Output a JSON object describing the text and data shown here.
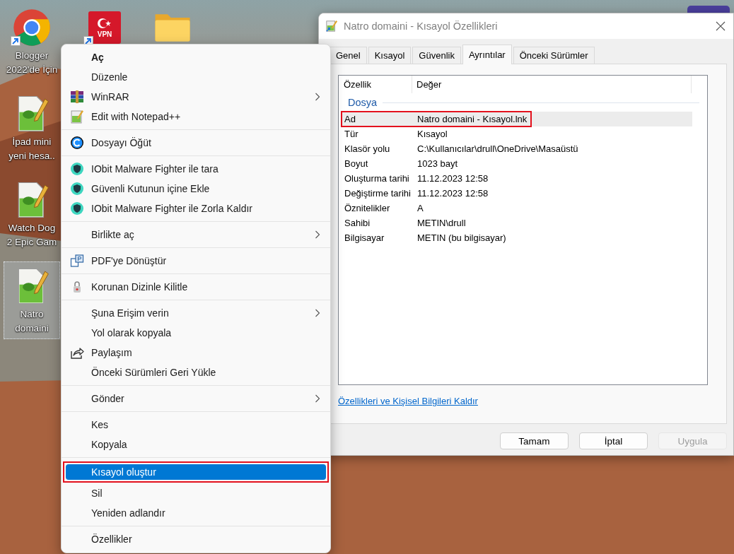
{
  "desktop": {
    "icons": [
      {
        "kind": "chrome",
        "shortcut": true,
        "selected": false,
        "label": [
          "Blogger",
          "2022'de İçin"
        ]
      },
      {
        "kind": "notepad",
        "shortcut": false,
        "selected": false,
        "label": [
          "İpad mini",
          "yeni hesa.."
        ]
      },
      {
        "kind": "notepad",
        "shortcut": false,
        "selected": false,
        "label": [
          "Watch Dog",
          "2 Epic Gam"
        ]
      },
      {
        "kind": "notepad",
        "shortcut": false,
        "selected": true,
        "label": [
          "Natro",
          "domaini"
        ]
      },
      {
        "kind": "vpn",
        "shortcut": true,
        "selected": false,
        "logo_text": "VPN"
      },
      {
        "kind": "folder",
        "shortcut": false,
        "selected": false
      }
    ]
  },
  "context_menu": {
    "items": [
      {
        "kind": "item",
        "label": "Aç",
        "default": true,
        "submenu": false,
        "selected": false,
        "annotated": false
      },
      {
        "kind": "item",
        "label": "Düzenle",
        "default": false,
        "submenu": false,
        "selected": false,
        "annotated": false
      },
      {
        "kind": "item",
        "label": "WinRAR",
        "default": false,
        "submenu": true,
        "selected": false,
        "annotated": false
      },
      {
        "kind": "item",
        "label": "Edit with Notepad++",
        "default": false,
        "submenu": false,
        "selected": false,
        "annotated": false
      },
      {
        "kind": "separator"
      },
      {
        "kind": "item",
        "label": "Dosyayı Öğüt",
        "default": false,
        "submenu": false,
        "selected": false,
        "annotated": false
      },
      {
        "kind": "separator"
      },
      {
        "kind": "item",
        "label": "IObit Malware Fighter ile tara",
        "default": false,
        "submenu": false,
        "selected": false,
        "annotated": false
      },
      {
        "kind": "item",
        "label": "Güvenli Kutunun içine Ekle",
        "default": false,
        "submenu": false,
        "selected": false,
        "annotated": false
      },
      {
        "kind": "item",
        "label": "IObit Malware Fighter ile Zorla Kaldır",
        "default": false,
        "submenu": false,
        "selected": false,
        "annotated": false
      },
      {
        "kind": "separator"
      },
      {
        "kind": "item",
        "label": "Birlikte aç",
        "default": false,
        "submenu": true,
        "selected": false,
        "annotated": false
      },
      {
        "kind": "separator"
      },
      {
        "kind": "item",
        "label": "PDF'ye Dönüştür",
        "default": false,
        "submenu": false,
        "selected": false,
        "annotated": false
      },
      {
        "kind": "separator"
      },
      {
        "kind": "item",
        "label": "Korunan Dizinle Kilitle",
        "default": false,
        "submenu": false,
        "selected": false,
        "annotated": false
      },
      {
        "kind": "separator"
      },
      {
        "kind": "item",
        "label": "Şuna Erişim verin",
        "default": false,
        "submenu": true,
        "selected": false,
        "annotated": false
      },
      {
        "kind": "item",
        "label": "Yol olarak kopyala",
        "default": false,
        "submenu": false,
        "selected": false,
        "annotated": false
      },
      {
        "kind": "item",
        "label": "Paylaşım",
        "default": false,
        "submenu": false,
        "selected": false,
        "annotated": false
      },
      {
        "kind": "item",
        "label": "Önceki Sürümleri Geri Yükle",
        "default": false,
        "submenu": false,
        "selected": false,
        "annotated": false
      },
      {
        "kind": "separator"
      },
      {
        "kind": "item",
        "label": "Gönder",
        "default": false,
        "submenu": true,
        "selected": false,
        "annotated": false
      },
      {
        "kind": "separator"
      },
      {
        "kind": "item",
        "label": "Kes",
        "default": false,
        "submenu": false,
        "selected": false,
        "annotated": false
      },
      {
        "kind": "item",
        "label": "Kopyala",
        "default": false,
        "submenu": false,
        "selected": false,
        "annotated": false
      },
      {
        "kind": "separator"
      },
      {
        "kind": "item",
        "label": "Kısayol oluştur",
        "default": false,
        "submenu": false,
        "selected": true,
        "annotated": true
      },
      {
        "kind": "item",
        "label": "Sil",
        "default": false,
        "submenu": false,
        "selected": false,
        "annotated": false
      },
      {
        "kind": "item",
        "label": "Yeniden adlandır",
        "default": false,
        "submenu": false,
        "selected": false,
        "annotated": false
      },
      {
        "kind": "separator"
      },
      {
        "kind": "item",
        "label": "Özellikler",
        "default": false,
        "submenu": false,
        "selected": false,
        "annotated": false
      }
    ]
  },
  "dialog": {
    "title": "Natro domaini - Kısayol Özellikleri",
    "tabs": [
      {
        "label": "Genel",
        "selected": false
      },
      {
        "label": "Kısayol",
        "selected": false
      },
      {
        "label": "Güvenlik",
        "selected": false
      },
      {
        "label": "Ayrıntılar",
        "selected": true
      },
      {
        "label": "Önceki Sürümler",
        "selected": false
      }
    ],
    "list": {
      "columns": [
        "Özellik",
        "Değer"
      ],
      "group": "Dosya",
      "rows": [
        {
          "property": "Ad",
          "value": "Natro domaini - Kısayol.lnk",
          "selected": true,
          "annotated": true
        },
        {
          "property": "Tür",
          "value": "Kısayol",
          "selected": false,
          "annotated": false
        },
        {
          "property": "Klasör yolu",
          "value": "C:\\Kullanıcılar\\drull\\OneDrive\\Masaüstü",
          "selected": false,
          "annotated": false
        },
        {
          "property": "Boyut",
          "value": "1023 bayt",
          "selected": false,
          "annotated": false
        },
        {
          "property": "Oluşturma tarihi",
          "value": "11.12.2023 12:58",
          "selected": false,
          "annotated": false
        },
        {
          "property": "Değiştirme tarihi",
          "value": "11.12.2023 12:58",
          "selected": false,
          "annotated": false
        },
        {
          "property": "Öznitelikler",
          "value": "A",
          "selected": false,
          "annotated": false
        },
        {
          "property": "Sahibi",
          "value": "METIN\\drull",
          "selected": false,
          "annotated": false
        },
        {
          "property": "Bilgisayar",
          "value": "METIN (bu bilgisayar)",
          "selected": false,
          "annotated": false
        }
      ]
    },
    "link": "Özellikleri ve Kişisel Bilgileri Kaldır",
    "buttons": [
      {
        "label": "Tamam",
        "disabled": false
      },
      {
        "label": "İptal",
        "disabled": false
      },
      {
        "label": "Uygula",
        "disabled": true
      }
    ]
  }
}
